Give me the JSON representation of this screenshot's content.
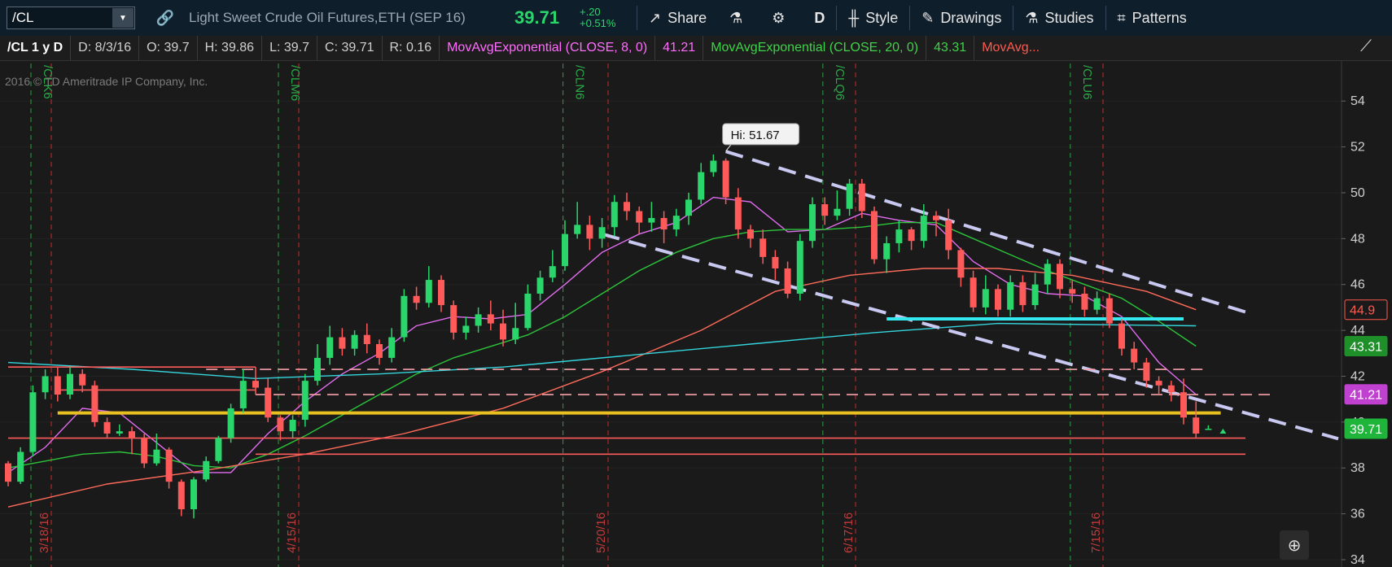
{
  "toolbar": {
    "symbol": "/CL",
    "description": "Light Sweet Crude Oil Futures,ETH (SEP 16)",
    "last": "39.71",
    "change": "+.20",
    "change_pct": "+0.51%",
    "buttons": {
      "share": "Share",
      "aggregation": "D",
      "style": "Style",
      "drawings": "Drawings",
      "studies": "Studies",
      "patterns": "Patterns"
    }
  },
  "infobar": {
    "symbol": "/CL 1 y D",
    "date": "D:  8/3/16",
    "open": "O:  39.7",
    "high": "H:  39.86",
    "low": "L:  39.7",
    "close": "C:  39.71",
    "range": "R:  0.16",
    "ema8_label": "MovAvgExponential (CLOSE, 8, 0)",
    "ema8_value": "41.21",
    "ema20_label": "MovAvgExponential (CLOSE, 20, 0)",
    "ema20_value": "43.31",
    "ma3_label": "MovAvg..."
  },
  "watermark": "2016 © TD Ameritrade IP Company, Inc.",
  "colors": {
    "up": "#2ad66b",
    "down": "#ff5a5a",
    "ema8": "#e26cf0",
    "ema20": "#2bc43a",
    "ma50": "#ff6b5a",
    "ma200": "#34d4dc"
  },
  "chart_data": {
    "type": "candlestick",
    "ylim": [
      34,
      55
    ],
    "y_ticks": [
      34,
      36,
      38,
      40,
      42,
      44,
      46,
      48,
      50,
      52,
      54
    ],
    "date_labels": [
      {
        "label": "3/18/16",
        "x": 0
      },
      {
        "label": "4/15/16",
        "x": 20
      },
      {
        "label": "5/20/16",
        "x": 45
      },
      {
        "label": "6/17/16",
        "x": 65
      },
      {
        "label": "7/15/16",
        "x": 85
      }
    ],
    "roll_labels": [
      {
        "label": "/CLK6",
        "x": 0
      },
      {
        "label": "/CLM6",
        "x": 20
      },
      {
        "label": "/CLN6",
        "x": 43
      },
      {
        "label": "/CLQ6",
        "x": 64
      },
      {
        "label": "/CLU6",
        "x": 84
      }
    ],
    "high_marker": {
      "label": "Hi: 51.67",
      "x": 58,
      "value": 51.67
    },
    "candles": [
      [
        38.2,
        37.4,
        38.3,
        37.2
      ],
      [
        37.4,
        38.7,
        38.9,
        37.3
      ],
      [
        38.7,
        41.3,
        41.6,
        38.5
      ],
      [
        41.3,
        42.0,
        42.3,
        41.0
      ],
      [
        42.0,
        41.2,
        42.4,
        40.9
      ],
      [
        41.2,
        42.1,
        42.4,
        41.0
      ],
      [
        42.1,
        41.6,
        42.3,
        41.3
      ],
      [
        41.6,
        40.0,
        41.8,
        39.8
      ],
      [
        40.0,
        39.5,
        40.2,
        39.3
      ],
      [
        39.5,
        39.6,
        39.9,
        39.4
      ],
      [
        39.6,
        39.3,
        39.8,
        38.6
      ],
      [
        39.3,
        38.2,
        39.5,
        38.0
      ],
      [
        38.2,
        38.8,
        39.5,
        38.1
      ],
      [
        38.8,
        37.4,
        38.9,
        37.1
      ],
      [
        37.4,
        36.2,
        37.5,
        35.9
      ],
      [
        36.2,
        37.5,
        37.6,
        35.8
      ],
      [
        37.5,
        38.3,
        38.5,
        37.4
      ],
      [
        38.3,
        39.3,
        39.4,
        38.2
      ],
      [
        39.3,
        40.6,
        40.8,
        39.1
      ],
      [
        40.6,
        41.8,
        42.3,
        40.4
      ],
      [
        41.8,
        41.5,
        42.4,
        41.2
      ],
      [
        41.5,
        40.2,
        41.9,
        40.0
      ],
      [
        40.2,
        39.6,
        40.3,
        39.2
      ],
      [
        39.6,
        40.1,
        40.3,
        39.3
      ],
      [
        40.1,
        41.8,
        42.1,
        39.8
      ],
      [
        41.8,
        42.8,
        43.4,
        41.6
      ],
      [
        42.8,
        43.7,
        44.2,
        42.5
      ],
      [
        43.7,
        43.2,
        44.1,
        42.9
      ],
      [
        43.2,
        43.8,
        44.0,
        42.9
      ],
      [
        43.8,
        43.4,
        44.3,
        43.0
      ],
      [
        43.4,
        42.8,
        43.6,
        42.5
      ],
      [
        42.8,
        43.7,
        44.1,
        42.6
      ],
      [
        43.7,
        45.5,
        45.8,
        43.5
      ],
      [
        45.5,
        45.2,
        45.9,
        44.9
      ],
      [
        45.2,
        46.2,
        46.8,
        45.0
      ],
      [
        46.2,
        45.1,
        46.4,
        44.8
      ],
      [
        45.1,
        43.9,
        45.3,
        43.6
      ],
      [
        43.9,
        44.2,
        44.6,
        43.6
      ],
      [
        44.2,
        44.7,
        45.0,
        43.9
      ],
      [
        44.7,
        44.3,
        45.3,
        44.0
      ],
      [
        44.3,
        43.6,
        44.9,
        43.3
      ],
      [
        43.6,
        44.1,
        45.2,
        43.4
      ],
      [
        44.1,
        45.6,
        46.0,
        44.0
      ],
      [
        45.6,
        46.3,
        46.6,
        45.3
      ],
      [
        46.3,
        46.8,
        47.5,
        46.1
      ],
      [
        46.8,
        48.2,
        48.8,
        46.6
      ],
      [
        48.2,
        48.6,
        49.6,
        48.0
      ],
      [
        48.6,
        48.0,
        49.0,
        47.5
      ],
      [
        48.0,
        48.5,
        48.9,
        47.6
      ],
      [
        48.5,
        49.6,
        49.9,
        48.1
      ],
      [
        49.6,
        49.2,
        50.0,
        48.8
      ],
      [
        49.2,
        48.7,
        49.4,
        48.2
      ],
      [
        48.7,
        48.9,
        49.6,
        48.3
      ],
      [
        48.9,
        48.4,
        49.2,
        47.8
      ],
      [
        48.4,
        49.0,
        49.3,
        48.1
      ],
      [
        49.0,
        49.7,
        50.0,
        48.6
      ],
      [
        49.7,
        50.9,
        51.3,
        49.5
      ],
      [
        50.9,
        51.4,
        51.67,
        50.7
      ],
      [
        51.4,
        49.8,
        51.5,
        49.5
      ],
      [
        49.8,
        48.4,
        50.2,
        48.0
      ],
      [
        48.4,
        48.0,
        48.6,
        47.6
      ],
      [
        48.0,
        47.2,
        48.4,
        46.9
      ],
      [
        47.2,
        46.7,
        47.5,
        46.2
      ],
      [
        46.7,
        45.6,
        47.0,
        45.4
      ],
      [
        45.6,
        47.9,
        48.2,
        45.3
      ],
      [
        47.9,
        49.5,
        49.8,
        47.6
      ],
      [
        49.5,
        49.0,
        49.8,
        48.6
      ],
      [
        49.0,
        49.3,
        50.1,
        48.8
      ],
      [
        49.3,
        50.4,
        50.6,
        49.0
      ],
      [
        50.4,
        49.2,
        50.6,
        48.9
      ],
      [
        49.2,
        47.1,
        49.4,
        46.9
      ],
      [
        47.1,
        47.8,
        48.1,
        46.5
      ],
      [
        47.8,
        48.4,
        48.8,
        47.4
      ],
      [
        48.4,
        47.9,
        48.5,
        47.5
      ],
      [
        47.9,
        49.0,
        49.5,
        47.6
      ],
      [
        49.0,
        48.8,
        49.2,
        48.1
      ],
      [
        48.8,
        47.5,
        49.3,
        47.1
      ],
      [
        47.5,
        46.3,
        47.6,
        45.9
      ],
      [
        46.3,
        45.0,
        46.6,
        44.8
      ],
      [
        45.0,
        45.8,
        46.4,
        44.7
      ],
      [
        45.8,
        44.9,
        46.0,
        44.6
      ],
      [
        44.9,
        46.1,
        46.4,
        44.6
      ],
      [
        46.1,
        45.1,
        46.4,
        44.8
      ],
      [
        45.1,
        46.0,
        46.5,
        44.9
      ],
      [
        46.0,
        46.9,
        47.1,
        45.6
      ],
      [
        46.9,
        45.8,
        47.1,
        45.4
      ],
      [
        45.8,
        45.6,
        46.2,
        45.2
      ],
      [
        45.6,
        44.9,
        45.9,
        44.6
      ],
      [
        44.9,
        45.4,
        45.7,
        44.7
      ],
      [
        45.4,
        44.3,
        45.6,
        44.1
      ],
      [
        44.3,
        43.2,
        44.5,
        42.9
      ],
      [
        43.2,
        42.6,
        43.5,
        42.3
      ],
      [
        42.6,
        41.8,
        42.8,
        41.5
      ],
      [
        41.8,
        41.6,
        42.0,
        41.2
      ],
      [
        41.6,
        41.3,
        41.8,
        40.9
      ],
      [
        41.3,
        40.2,
        41.9,
        39.9
      ],
      [
        40.2,
        39.5,
        40.9,
        39.3
      ],
      [
        39.7,
        39.71,
        39.86,
        39.7
      ]
    ],
    "series": [
      {
        "name": "MovAvgExponential (CLOSE, 8, 0)",
        "color": "#e26cf0",
        "x": [
          0,
          3,
          6,
          9,
          12,
          15,
          18,
          21,
          24,
          27,
          30,
          33,
          36,
          39,
          42,
          45,
          48,
          51,
          54,
          57,
          60,
          63,
          66,
          69,
          72,
          75,
          78,
          81,
          84,
          87,
          90,
          93,
          96
        ],
        "values": [
          37.8,
          38.9,
          40.6,
          40.4,
          39.1,
          37.8,
          37.8,
          39.5,
          40.9,
          42.1,
          43.0,
          44.2,
          44.6,
          44.5,
          44.7,
          46.0,
          47.4,
          48.2,
          48.7,
          49.8,
          49.6,
          48.3,
          48.4,
          49.1,
          48.8,
          48.6,
          47.0,
          46.0,
          45.6,
          45.5,
          44.6,
          42.6,
          41.2
        ]
      },
      {
        "name": "MovAvgExponential (CLOSE, 20, 0)",
        "color": "#2bc43a",
        "x": [
          0,
          3,
          6,
          9,
          12,
          15,
          18,
          21,
          24,
          27,
          30,
          33,
          36,
          39,
          42,
          45,
          48,
          51,
          54,
          57,
          60,
          63,
          66,
          69,
          72,
          75,
          78,
          81,
          84,
          87,
          90,
          93,
          96
        ],
        "values": [
          38.0,
          38.3,
          38.6,
          38.7,
          38.5,
          38.1,
          38.0,
          38.6,
          39.4,
          40.3,
          41.2,
          42.1,
          42.8,
          43.3,
          43.8,
          44.6,
          45.6,
          46.6,
          47.4,
          48.0,
          48.3,
          48.4,
          48.4,
          48.5,
          48.7,
          48.7,
          48.0,
          47.3,
          46.6,
          46.0,
          45.4,
          44.4,
          43.31
        ]
      },
      {
        "name": "MovAvg",
        "color": "#ff6b5a",
        "x": [
          0,
          8,
          16,
          24,
          32,
          40,
          48,
          56,
          62,
          68,
          74,
          80,
          86,
          92,
          96
        ],
        "values": [
          36.3,
          37.3,
          37.9,
          38.6,
          39.5,
          40.6,
          42.2,
          44.0,
          45.7,
          46.4,
          46.7,
          46.7,
          46.4,
          45.7,
          44.9
        ]
      },
      {
        "name": "MovAvg",
        "color": "#34d4dc",
        "x": [
          0,
          10,
          20,
          30,
          40,
          50,
          60,
          70,
          80,
          96
        ],
        "values": [
          42.6,
          42.3,
          41.9,
          42.1,
          42.4,
          42.9,
          43.4,
          43.9,
          44.3,
          44.2
        ]
      }
    ],
    "drawings": [
      {
        "kind": "trend",
        "style": "dashed",
        "color": "#c8c8f0",
        "points": [
          [
            58,
            51.8
          ],
          [
            100,
            44.8
          ]
        ]
      },
      {
        "kind": "trend",
        "style": "dashed",
        "color": "#c8c8f0",
        "points": [
          [
            48,
            48.2
          ],
          [
            108,
            39.2
          ]
        ]
      },
      {
        "kind": "level",
        "style": "solid",
        "color": "#e8c020",
        "value": 40.4,
        "x": [
          4,
          98
        ]
      },
      {
        "kind": "level",
        "style": "solid",
        "color": "#34e8f0",
        "value": 44.5,
        "x": [
          71,
          95
        ]
      },
      {
        "kind": "level",
        "style": "dashed",
        "color": "#f4a0a8",
        "value": 42.3,
        "x": [
          16,
          97
        ]
      },
      {
        "kind": "level",
        "style": "dashed",
        "color": "#f4a0a8",
        "value": 41.2,
        "x": [
          20,
          102
        ]
      },
      {
        "kind": "level",
        "style": "solid",
        "color": "#ff5a5a",
        "value": 42.4,
        "x": [
          0,
          20
        ]
      },
      {
        "kind": "level",
        "style": "solid",
        "color": "#ff5a5a",
        "value": 41.4,
        "x": [
          4,
          20
        ]
      },
      {
        "kind": "level",
        "style": "solid",
        "color": "#ff5a5a",
        "value": 39.3,
        "x": [
          0,
          100
        ]
      },
      {
        "kind": "level",
        "style": "solid",
        "color": "#ff5a5a",
        "value": 38.6,
        "x": [
          20,
          100
        ]
      }
    ],
    "price_tags": [
      {
        "value": 44.9,
        "label": "44.9",
        "bg": "#1a1a1a",
        "fg": "#ff5a4f",
        "border": "#ff5a4f"
      },
      {
        "value": 43.31,
        "label": "43.31",
        "bg": "#1f8f2a",
        "fg": "#ffffff",
        "border": "#1f8f2a"
      },
      {
        "value": 41.21,
        "label": "41.21",
        "bg": "#c040d0",
        "fg": "#ffffff",
        "border": "#c040d0"
      },
      {
        "value": 39.71,
        "label": "39.71",
        "bg": "#1fb53a",
        "fg": "#ffffff",
        "border": "#1fb53a"
      }
    ]
  }
}
